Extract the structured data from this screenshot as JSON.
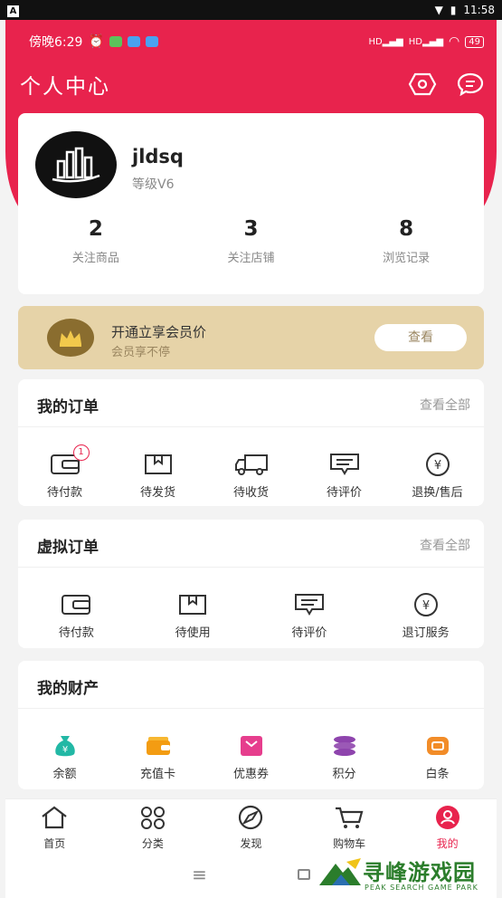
{
  "system": {
    "time": "11:58"
  },
  "status": {
    "time": "傍晚6:29",
    "battery": "49"
  },
  "header": {
    "title": "个人中心"
  },
  "profile": {
    "name": "jldsq",
    "level": "等级V6"
  },
  "stats": [
    {
      "num": "2",
      "label": "关注商品"
    },
    {
      "num": "3",
      "label": "关注店铺"
    },
    {
      "num": "8",
      "label": "浏览记录"
    }
  ],
  "vip": {
    "title": "开通立享会员价",
    "subtitle": "会员享不停",
    "button": "查看"
  },
  "orders": {
    "title": "我的订单",
    "more": "查看全部",
    "items": [
      {
        "label": "待付款",
        "icon": "wallet-icon",
        "badge": "1"
      },
      {
        "label": "待发货",
        "icon": "box-icon"
      },
      {
        "label": "待收货",
        "icon": "truck-icon"
      },
      {
        "label": "待评价",
        "icon": "comment-icon"
      },
      {
        "label": "退换/售后",
        "icon": "yen-circle-icon"
      }
    ]
  },
  "virtual": {
    "title": "虚拟订单",
    "more": "查看全部",
    "items": [
      {
        "label": "待付款",
        "icon": "wallet-icon"
      },
      {
        "label": "待使用",
        "icon": "box-icon"
      },
      {
        "label": "待评价",
        "icon": "comment-icon"
      },
      {
        "label": "退订服务",
        "icon": "yen-circle-icon"
      }
    ]
  },
  "assets": {
    "title": "我的财产",
    "items": [
      {
        "label": "余额",
        "icon": "money-bag-icon"
      },
      {
        "label": "充值卡",
        "icon": "card-icon"
      },
      {
        "label": "优惠券",
        "icon": "coupon-icon"
      },
      {
        "label": "积分",
        "icon": "coins-icon"
      },
      {
        "label": "白条",
        "icon": "ticket-icon"
      }
    ]
  },
  "tabs": [
    {
      "label": "首页",
      "icon": "home-icon"
    },
    {
      "label": "分类",
      "icon": "grid-icon"
    },
    {
      "label": "发现",
      "icon": "compass-icon"
    },
    {
      "label": "购物车",
      "icon": "cart-icon"
    },
    {
      "label": "我的",
      "icon": "user-icon"
    }
  ],
  "watermark": {
    "big": "寻峰游戏园",
    "small": "PEAK SEARCH GAME PARK"
  },
  "colors": {
    "brand": "#e8234d",
    "vip_bg": "#e6d3a8"
  }
}
